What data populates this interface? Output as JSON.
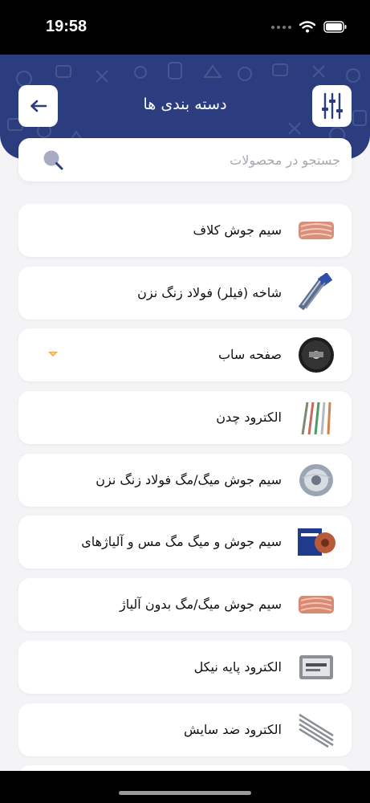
{
  "status_bar": {
    "time": "19:58"
  },
  "header": {
    "title": "دسته بندی ها"
  },
  "search": {
    "placeholder": "جستجو در محصولات",
    "value": ""
  },
  "categories": [
    {
      "label": "سیم جوش کلاف",
      "thumb": "wire-coil-copper"
    },
    {
      "label": "شاخه (فیلر) فولاد زنگ نزن",
      "thumb": "filler-rods"
    },
    {
      "label": "صفحه ساب",
      "thumb": "grinding-disc"
    },
    {
      "label": "الکترود چدن",
      "thumb": "electrodes-colored"
    },
    {
      "label": "سیم جوش میگ/مگ فولاد زنگ نزن",
      "thumb": "wire-spool-silver"
    },
    {
      "label": "سیم جوش و میگ مگ مس و آلیاژهای",
      "thumb": "wire-box-copper"
    },
    {
      "label": "سیم جوش میگ/مگ بدون آلیاژ",
      "thumb": "wire-coil-copper"
    },
    {
      "label": "الکترود پایه نیکل",
      "thumb": "electrode-box"
    },
    {
      "label": "الکترود ضد سایش",
      "thumb": "electrodes-gray"
    }
  ],
  "colors": {
    "header": "#2b3d7f",
    "background": "#f4f4f6",
    "badge": "#f4a640"
  }
}
